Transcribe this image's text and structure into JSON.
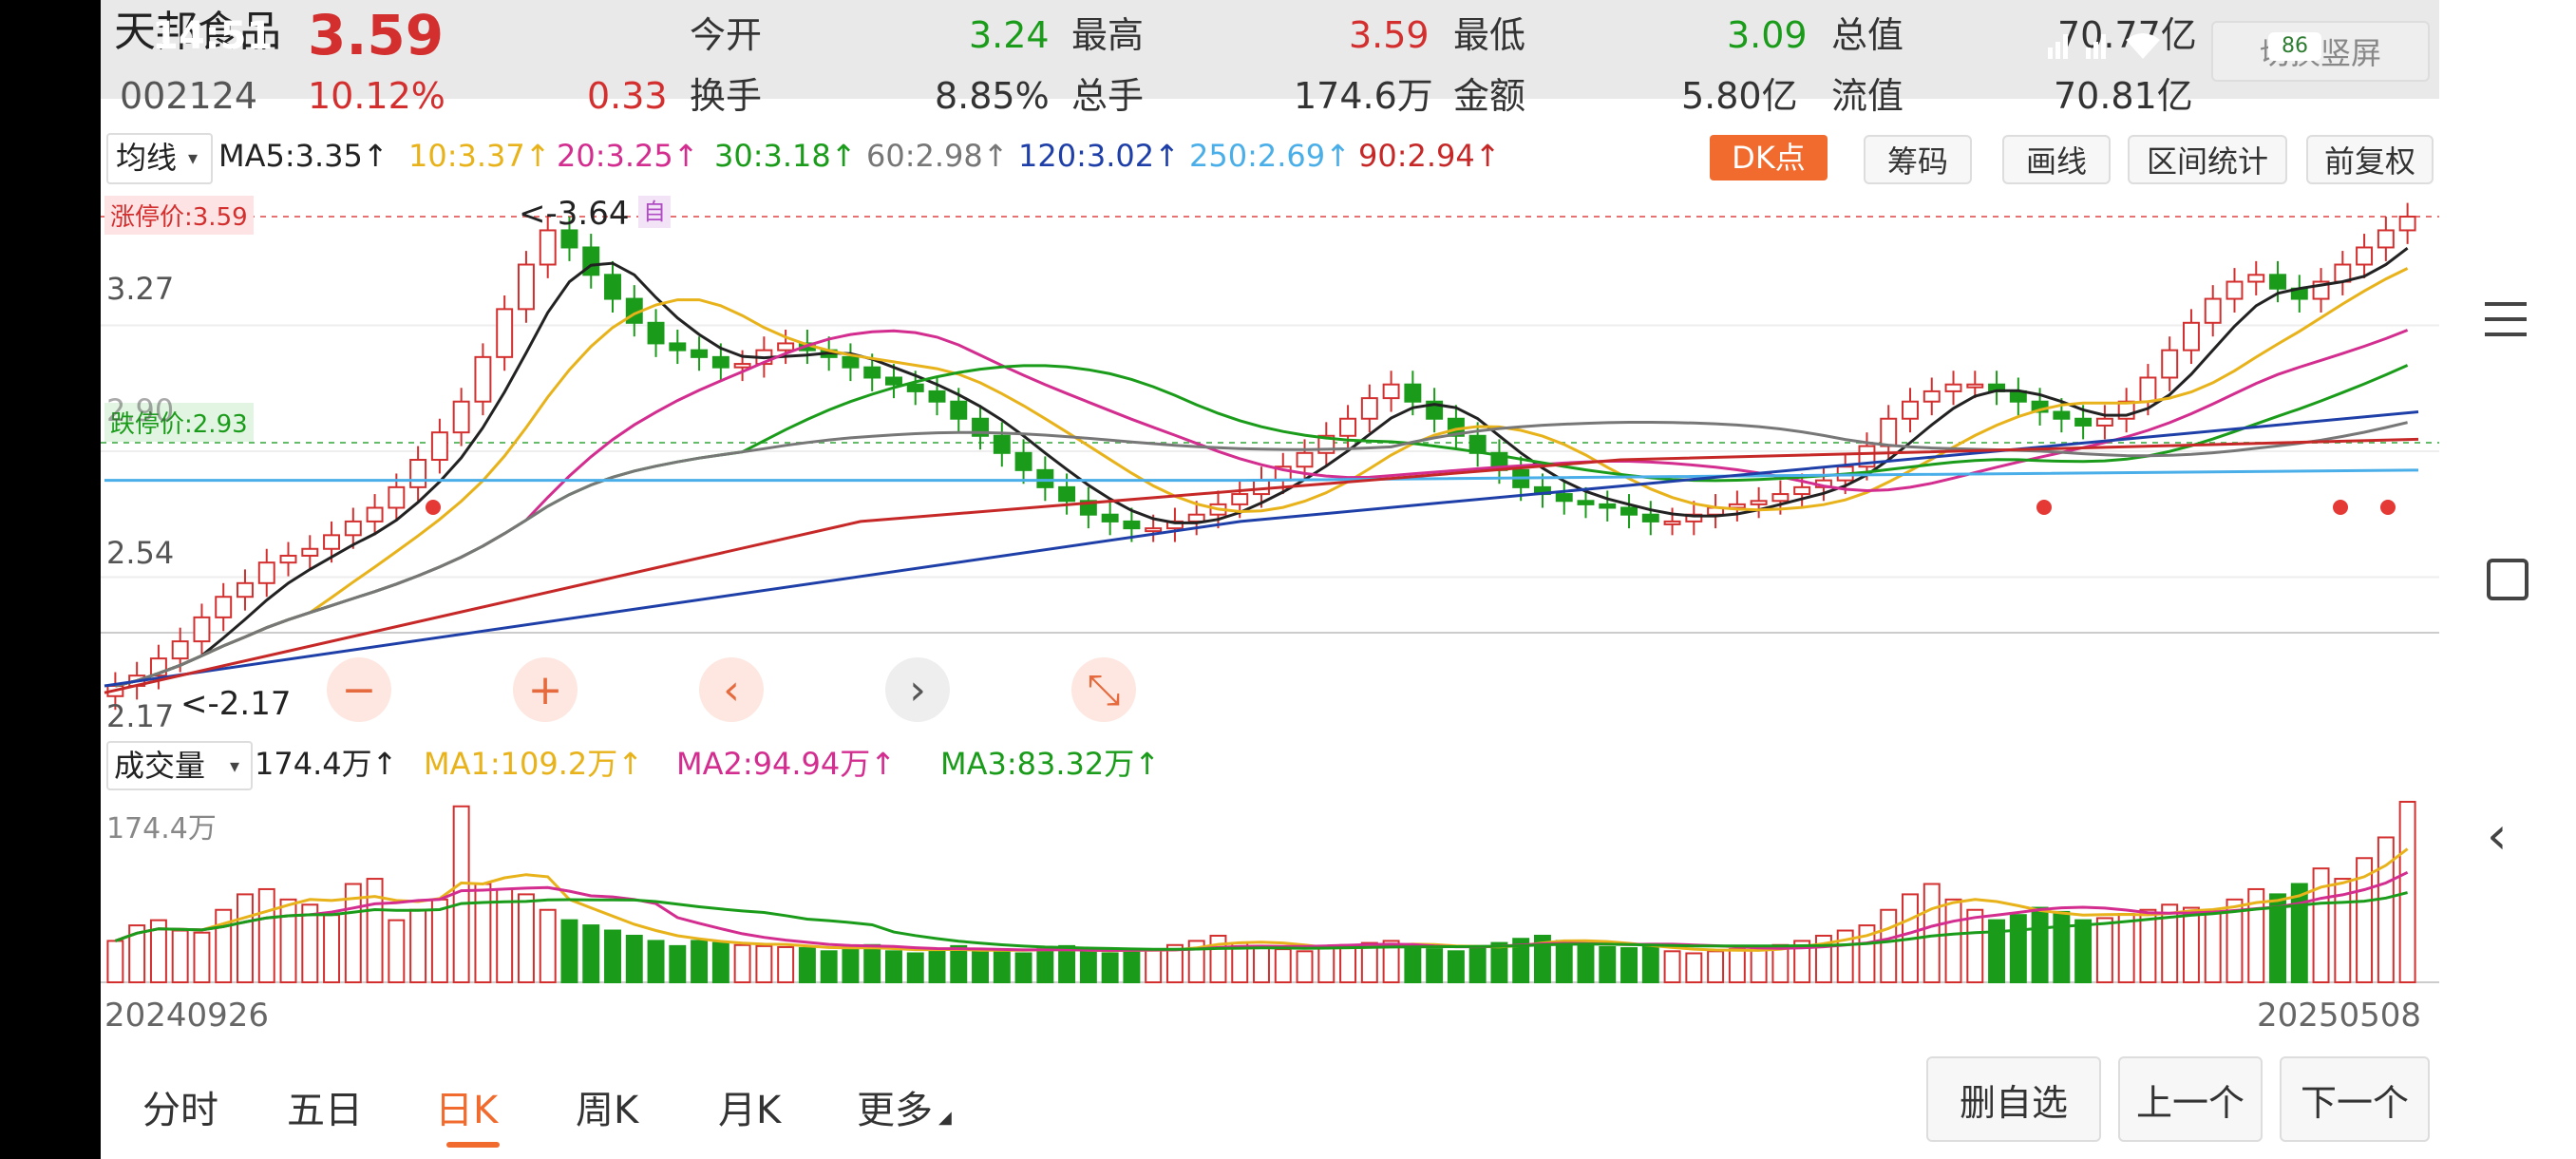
{
  "status_bar": {
    "time": "14:51",
    "battery": "86"
  },
  "header": {
    "stock_name": "天邦食品",
    "price": "3.59",
    "code": "002124",
    "change_pct": "10.12%",
    "change": "0.33",
    "stats": [
      {
        "label": "今开",
        "value": "3.24"
      },
      {
        "label": "最高",
        "value": "3.59"
      },
      {
        "label": "最低",
        "value": "3.09"
      },
      {
        "label": "总值",
        "value": "70.77亿"
      },
      {
        "label": "换手",
        "value": "8.85%"
      },
      {
        "label": "总手",
        "value": "174.6万"
      },
      {
        "label": "金额",
        "value": "5.80亿"
      },
      {
        "label": "流值",
        "value": "70.81亿"
      }
    ],
    "switch_button": "切换竖屏"
  },
  "ma_bar": {
    "selector": "均线",
    "items": [
      {
        "text": "MA5:3.35↑",
        "color": "#222222"
      },
      {
        "text": "10:3.37↑",
        "color": "#e8b21a"
      },
      {
        "text": "20:3.25↑",
        "color": "#d22d8f"
      },
      {
        "text": "30:3.18↑",
        "color": "#1a9c1a"
      },
      {
        "text": "60:2.98↑",
        "color": "#777777"
      },
      {
        "text": "120:3.02↑",
        "color": "#1f3fa8"
      },
      {
        "text": "250:2.69↑",
        "color": "#4aaee8"
      },
      {
        "text": "90:2.94↑",
        "color": "#c62828"
      }
    ],
    "dk_button": "DK点",
    "tools": [
      "筹码",
      "画线",
      "区间统计",
      "前复权"
    ]
  },
  "price_chart": {
    "limit_up_label": "涨停价:3.59",
    "limit_down_label": "跌停价:2.93",
    "axis_labels": [
      "3.27",
      "2.90",
      "2.54",
      "2.17"
    ],
    "high_marker": "<-3.64",
    "low_marker": "<-2.17",
    "self_tag": "自",
    "controls": [
      "−",
      "+",
      "‹",
      "›",
      "⤡"
    ]
  },
  "volume_bar": {
    "selector": "成交量",
    "value": "174.4万↑",
    "items": [
      {
        "text": "MA1:109.2万↑",
        "color": "#e8b21a"
      },
      {
        "text": "MA2:94.94万↑",
        "color": "#d22d8f"
      },
      {
        "text": "MA3:83.32万↑",
        "color": "#1a9c1a"
      }
    ],
    "axis_label": "174.4万"
  },
  "dates": {
    "start": "20240926",
    "end": "20250508"
  },
  "tabs": [
    {
      "label": "分时",
      "active": false
    },
    {
      "label": "五日",
      "active": false
    },
    {
      "label": "日K",
      "active": true
    },
    {
      "label": "周K",
      "active": false
    },
    {
      "label": "月K",
      "active": false
    },
    {
      "label": "更多",
      "active": false
    }
  ],
  "actions": [
    "删自选",
    "上一个",
    "下一个"
  ],
  "chart_data": {
    "type": "candlestick",
    "x_range": [
      "20240926",
      "20250508"
    ],
    "y_range": [
      2.17,
      3.64
    ],
    "y_ticks": [
      3.27,
      2.9,
      2.54,
      2.17
    ],
    "limit_up": 3.59,
    "limit_down": 2.93,
    "close_approx": [
      2.22,
      2.25,
      2.3,
      2.35,
      2.42,
      2.48,
      2.52,
      2.58,
      2.6,
      2.62,
      2.66,
      2.7,
      2.74,
      2.8,
      2.88,
      2.96,
      3.05,
      3.18,
      3.32,
      3.45,
      3.55,
      3.5,
      3.42,
      3.35,
      3.28,
      3.22,
      3.2,
      3.18,
      3.15,
      3.16,
      3.2,
      3.22,
      3.2,
      3.18,
      3.15,
      3.12,
      3.1,
      3.08,
      3.05,
      3.0,
      2.95,
      2.9,
      2.85,
      2.8,
      2.76,
      2.72,
      2.7,
      2.68,
      2.68,
      2.7,
      2.72,
      2.75,
      2.78,
      2.82,
      2.86,
      2.9,
      2.95,
      3.0,
      3.06,
      3.1,
      3.05,
      3.0,
      2.95,
      2.9,
      2.85,
      2.8,
      2.78,
      2.76,
      2.75,
      2.74,
      2.72,
      2.7,
      2.7,
      2.72,
      2.74,
      2.75,
      2.76,
      2.78,
      2.8,
      2.82,
      2.86,
      2.92,
      3.0,
      3.05,
      3.08,
      3.1,
      3.1,
      3.08,
      3.05,
      3.02,
      3.0,
      2.98,
      3.0,
      3.05,
      3.12,
      3.2,
      3.28,
      3.35,
      3.4,
      3.42,
      3.38,
      3.35,
      3.4,
      3.45,
      3.5,
      3.55,
      3.59
    ],
    "volume_approx": [
      40,
      55,
      60,
      50,
      48,
      70,
      85,
      90,
      80,
      75,
      65,
      95,
      100,
      60,
      70,
      80,
      170,
      95,
      90,
      85,
      70,
      60,
      55,
      50,
      45,
      40,
      35,
      40,
      38,
      36,
      35,
      34,
      33,
      30,
      34,
      36,
      30,
      28,
      30,
      35,
      32,
      30,
      28,
      32,
      35,
      30,
      28,
      30,
      32,
      36,
      40,
      45,
      38,
      35,
      32,
      30,
      34,
      36,
      38,
      40,
      36,
      32,
      30,
      35,
      38,
      42,
      45,
      40,
      36,
      34,
      33,
      35,
      30,
      28,
      30,
      32,
      34,
      36,
      40,
      45,
      50,
      55,
      70,
      85,
      95,
      80,
      70,
      60,
      65,
      72,
      68,
      60,
      62,
      66,
      70,
      75,
      72,
      68,
      80,
      90,
      85,
      95,
      110,
      100,
      120,
      140,
      174.4
    ]
  }
}
